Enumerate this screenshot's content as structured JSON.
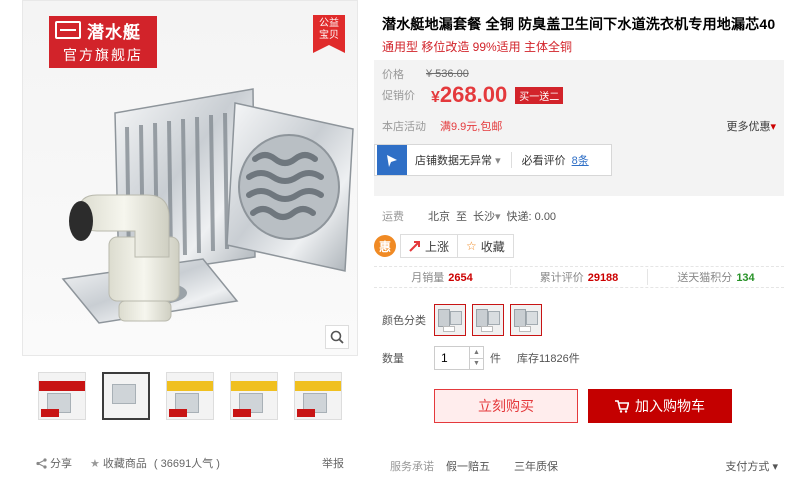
{
  "gallery": {
    "brand_name": "潜水艇",
    "brand_store": "官方旗舰店",
    "charity_tag_line1": "公益",
    "charity_tag_line2": "宝贝",
    "thumbnails": [
      {
        "caption": "",
        "active": false
      },
      {
        "caption": "",
        "active": true
      },
      {
        "caption": "",
        "active": false
      },
      {
        "caption": "",
        "active": false
      },
      {
        "caption": "",
        "active": false
      }
    ]
  },
  "left_footer": {
    "share": "分享",
    "collect": "收藏商品",
    "popularity": "( 36691人气 )",
    "report": "举报"
  },
  "product": {
    "title": "潜水艇地漏套餐 全铜 防臭盖卫生间下水道洗衣机专用地漏芯40",
    "subtitle": "通用型 移位改造 99%适用 主体全铜"
  },
  "price": {
    "orig_label": "价格",
    "orig_value": "¥ 536.00",
    "promo_label": "促销价",
    "yen": "¥",
    "current_value": "268.00",
    "promo_tag": "买一送二",
    "activity_label": "本店活动",
    "activity_value": "满9.9元,包邮",
    "more_promo": "更多优惠"
  },
  "store_data": {
    "text": "店铺数据无异常",
    "review_label": "必看评价",
    "review_count": "8条"
  },
  "shipping": {
    "label": "运费",
    "from": "北京",
    "to_word": "至",
    "to": "长沙",
    "fee": "快递: 0.00"
  },
  "trend": {
    "badge": "惠",
    "up_label": "上涨",
    "fav_label": "收藏"
  },
  "stats": {
    "monthly_label": "月销量",
    "monthly_value": "2654",
    "reviews_label": "累计评价",
    "reviews_value": "29188",
    "points_label": "送天猫积分",
    "points_value": "134"
  },
  "options": {
    "color_label": "颜色分类",
    "qty_label": "数量",
    "qty_value": "1",
    "qty_unit": "件",
    "stock": "库存11826件"
  },
  "actions": {
    "buy_now": "立刻购买",
    "add_cart": "加入购物车"
  },
  "promise": {
    "label": "服务承诺",
    "p1": "假一赔五",
    "p2": "三年质保",
    "pay": "支付方式"
  },
  "colors": {
    "accent": "#e4393c",
    "brand": "#d2232a",
    "cart": "#c40000",
    "link": "#2f6fc6"
  }
}
